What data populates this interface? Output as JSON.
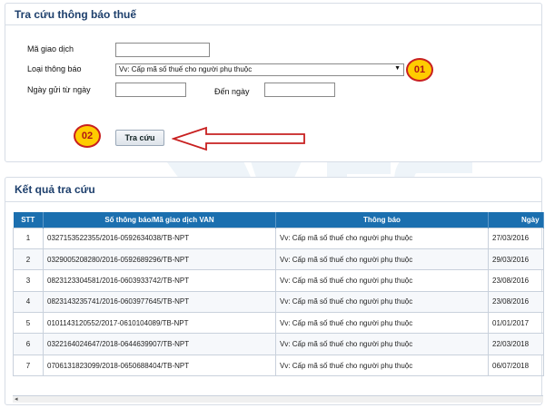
{
  "search": {
    "title": "Tra cứu thông báo thuế",
    "transaction_code_label": "Mã giao dịch",
    "transaction_code_value": "",
    "notice_type_label": "Loại thông báo",
    "notice_type_selected": "Vv: Cấp mã số thuế cho người phụ thuộc",
    "date_from_label": "Ngày gửi từ ngày",
    "date_from_value": "",
    "date_to_label": "Đến ngày",
    "date_to_value": "",
    "submit_label": "Tra cứu"
  },
  "annotations": {
    "step1": "01",
    "step2": "02",
    "arrow_color": "#c82020",
    "badge_color": "#ffcc00"
  },
  "results": {
    "title": "Kết quả tra cứu",
    "columns": {
      "stt": "STT",
      "number": "Số thông báo/Mã giao dịch VAN",
      "notice": "Thông báo",
      "date": "Ngày"
    },
    "rows": [
      {
        "stt": "1",
        "number": "0327153522355/2016-0592634038/TB-NPT",
        "notice": "Vv: Cấp mã số thuế cho người phụ thuộc",
        "date": "27/03/2016"
      },
      {
        "stt": "2",
        "number": "0329005208280/2016-0592689296/TB-NPT",
        "notice": "Vv: Cấp mã số thuế cho người phụ thuộc",
        "date": "29/03/2016"
      },
      {
        "stt": "3",
        "number": "0823123304581/2016-0603933742/TB-NPT",
        "notice": "Vv: Cấp mã số thuế cho người phụ thuộc",
        "date": "23/08/2016"
      },
      {
        "stt": "4",
        "number": "0823143235741/2016-0603977645/TB-NPT",
        "notice": "Vv: Cấp mã số thuế cho người phụ thuộc",
        "date": "23/08/2016"
      },
      {
        "stt": "5",
        "number": "0101143120552/2017-0610104089/TB-NPT",
        "notice": "Vv: Cấp mã số thuế cho người phụ thuộc",
        "date": "01/01/2017"
      },
      {
        "stt": "6",
        "number": "0322164024647/2018-0644639907/TB-NPT",
        "notice": "Vv: Cấp mã số thuế cho người phụ thuộc",
        "date": "22/03/2018"
      },
      {
        "stt": "7",
        "number": "0706131823099/2018-0650688404/TB-NPT",
        "notice": "Vv: Cấp mã số thuế cho người phụ thuộc",
        "date": "06/07/2018"
      }
    ],
    "scroll_left_icon": "arrow-left-icon"
  },
  "colors": {
    "header_bg": "#1b6faf",
    "title_text": "#1d3f6c"
  }
}
